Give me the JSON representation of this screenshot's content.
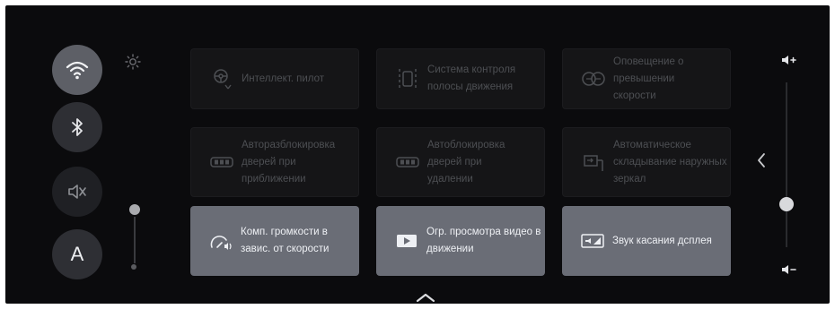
{
  "quick_controls": [
    {
      "name": "wifi",
      "icon": "wifi-icon",
      "active": true
    },
    {
      "name": "bluetooth",
      "icon": "bluetooth-icon",
      "active": false
    },
    {
      "name": "mute",
      "icon": "speaker-muted-icon",
      "active": false
    },
    {
      "name": "auto-brightness",
      "icon": "letter-a-icon",
      "label": "A",
      "active": false
    }
  ],
  "brightness_icon": "sun-icon",
  "brightness_level": 0.75,
  "cards": [
    {
      "id": "intellect-pilot",
      "icon": "steering-assist-icon",
      "label": "Интеллект. пилот",
      "state": "disabled"
    },
    {
      "id": "lane-control",
      "icon": "lane-assist-icon",
      "label": "Система контроля полосы движения",
      "state": "disabled"
    },
    {
      "id": "speed-warning",
      "icon": "speed-limit-icon",
      "label": "Оповещение о превышении скорости",
      "state": "disabled"
    },
    {
      "id": "auto-unlock",
      "icon": "key-fob-icon",
      "label": "Авторазблокировка дверей при приближении",
      "state": "disabled"
    },
    {
      "id": "auto-lock",
      "icon": "key-fob-icon",
      "label": "Автоблокировка дверей при удалении",
      "state": "disabled"
    },
    {
      "id": "mirror-fold",
      "icon": "mirror-fold-icon",
      "label": "Автоматическое складывание наружных зеркал",
      "state": "disabled"
    },
    {
      "id": "speed-volume",
      "icon": "speed-volume-icon",
      "label": "Комп. громкости в завис. от скорости",
      "state": "active"
    },
    {
      "id": "video-restrict",
      "icon": "video-restrict-icon",
      "label": "Огр. просмотра видео в движении",
      "state": "active"
    },
    {
      "id": "touch-sound",
      "icon": "touch-sound-icon",
      "label": "Звук касания дсплея",
      "state": "active"
    }
  ],
  "volume_level": 0.3,
  "colors": {
    "background": "#0b0b0d",
    "active_card": "#6a6d76",
    "inactive_card": "#151517",
    "active_circle": "#5d5f66"
  }
}
